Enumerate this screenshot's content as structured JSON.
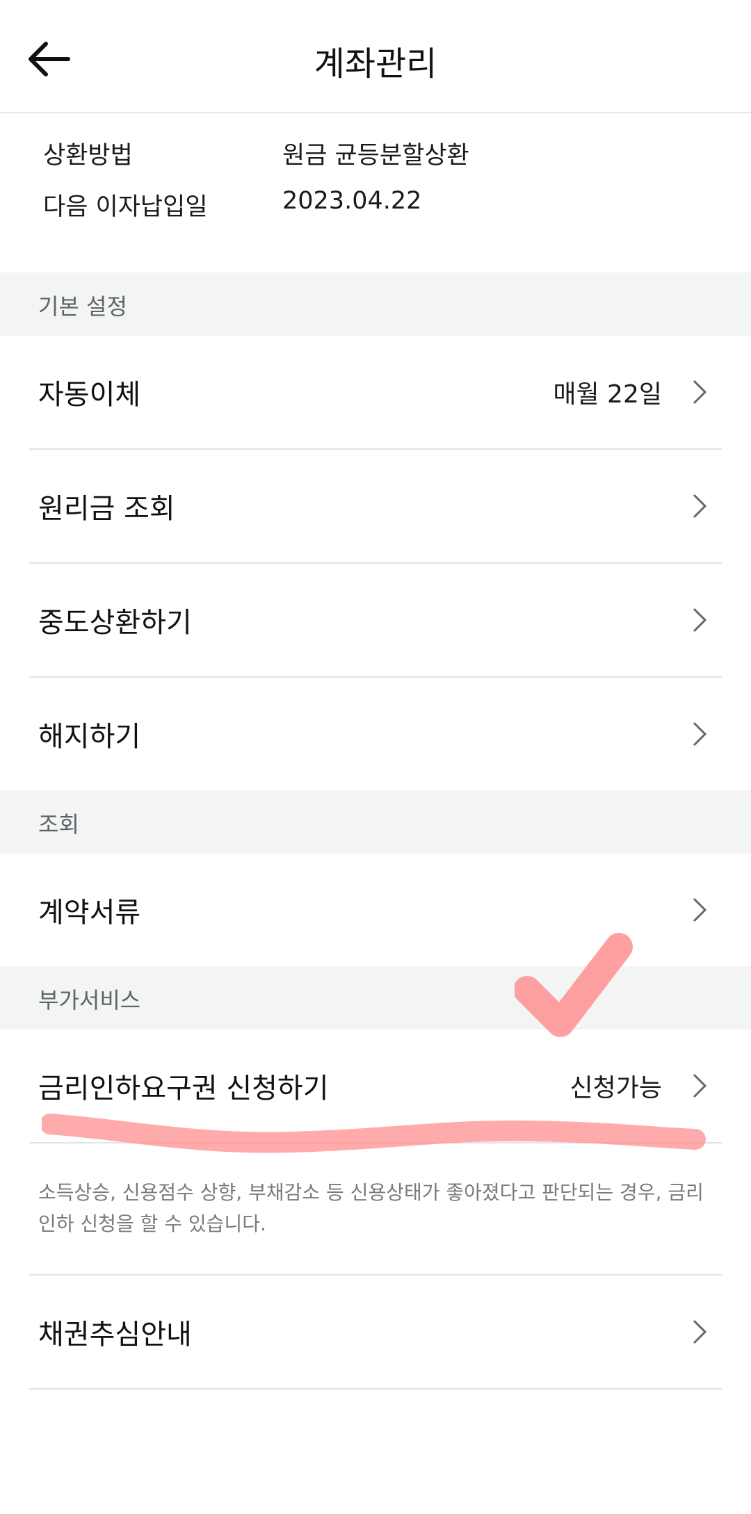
{
  "header": {
    "title": "계좌관리",
    "back_icon": "arrow-left-icon"
  },
  "info": {
    "repayment_method_label": "상환방법",
    "repayment_method_value": "원금 균등분할상환",
    "next_interest_label": "다음 이자납입일",
    "next_interest_value": "2023.04.22"
  },
  "sections": {
    "basic": "기본 설정",
    "inquiry": "조회",
    "extra": "부가서비스"
  },
  "menu": {
    "auto_transfer": {
      "label": "자동이체",
      "value": "매월 22일"
    },
    "principal_inquiry": {
      "label": "원리금 조회"
    },
    "early_repayment": {
      "label": "중도상환하기"
    },
    "cancel": {
      "label": "해지하기"
    },
    "contract_docs": {
      "label": "계약서류"
    },
    "rate_cut": {
      "label": "금리인하요구권 신청하기",
      "value": "신청가능"
    },
    "rate_cut_desc": "소득상승, 신용점수 상향, 부채감소 등 신용상태가 좋아졌다고 판단되는 경우, 금리인하 신청을 할 수 있습니다.",
    "debt_collection": {
      "label": "채권추심안내"
    }
  },
  "colors": {
    "section_bg": "#f3f4f4",
    "annotation": "#ff8f8f"
  }
}
